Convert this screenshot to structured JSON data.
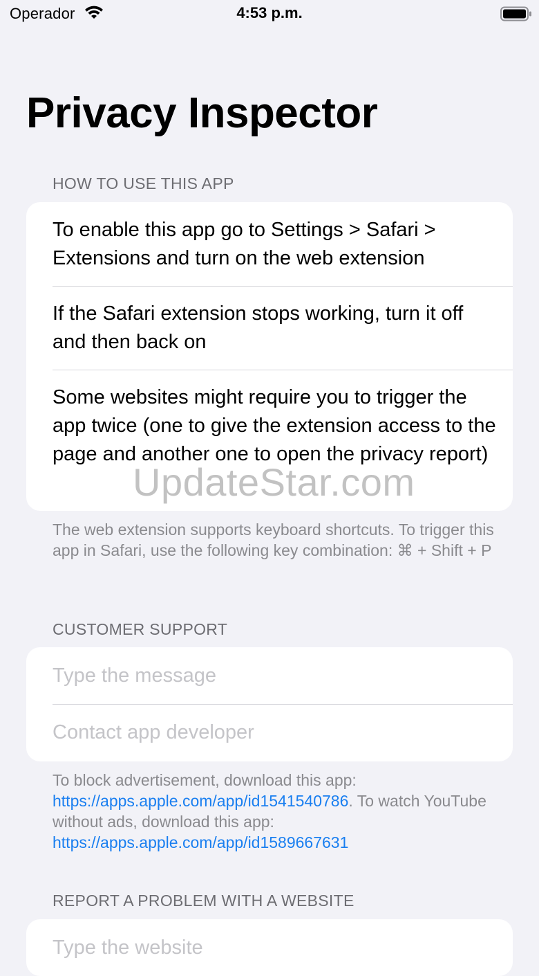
{
  "status_bar": {
    "carrier": "Operador",
    "time": "4:53 p.m.",
    "wifi_icon": "wifi-icon",
    "battery_icon": "battery-icon"
  },
  "page": {
    "title": "Privacy Inspector"
  },
  "how_to": {
    "header": "HOW TO USE THIS APP",
    "items": [
      "To enable this app go to Settings > Safari > Extensions and turn on the web extension",
      "If the Safari extension stops working, turn it off and then back on",
      "Some websites might require you to trigger the app twice (one to give the extension access to the page and another one to open the privacy report)"
    ],
    "footer": "The web extension supports keyboard shortcuts. To trigger this app in Safari, use the following key combination: ⌘ + Shift + P"
  },
  "customer_support": {
    "header": "CUSTOMER SUPPORT",
    "message_placeholder": "Type the message",
    "contact_placeholder": "Contact app developer",
    "footer_part1": "To block advertisement, download this app: ",
    "footer_link1": "https://apps.apple.com/app/id1541540786",
    "footer_part2": ". To watch YouTube without ads, download this app: ",
    "footer_link2": "https://apps.apple.com/app/id1589667631"
  },
  "report_problem": {
    "header": "REPORT A PROBLEM WITH A WEBSITE",
    "website_placeholder": "Type the website"
  },
  "watermark": "UpdateStar.com",
  "colors": {
    "background": "#f2f2f7",
    "link": "#1a7ff0",
    "secondary_text": "#6d6d72",
    "placeholder": "#c4c4c8"
  }
}
